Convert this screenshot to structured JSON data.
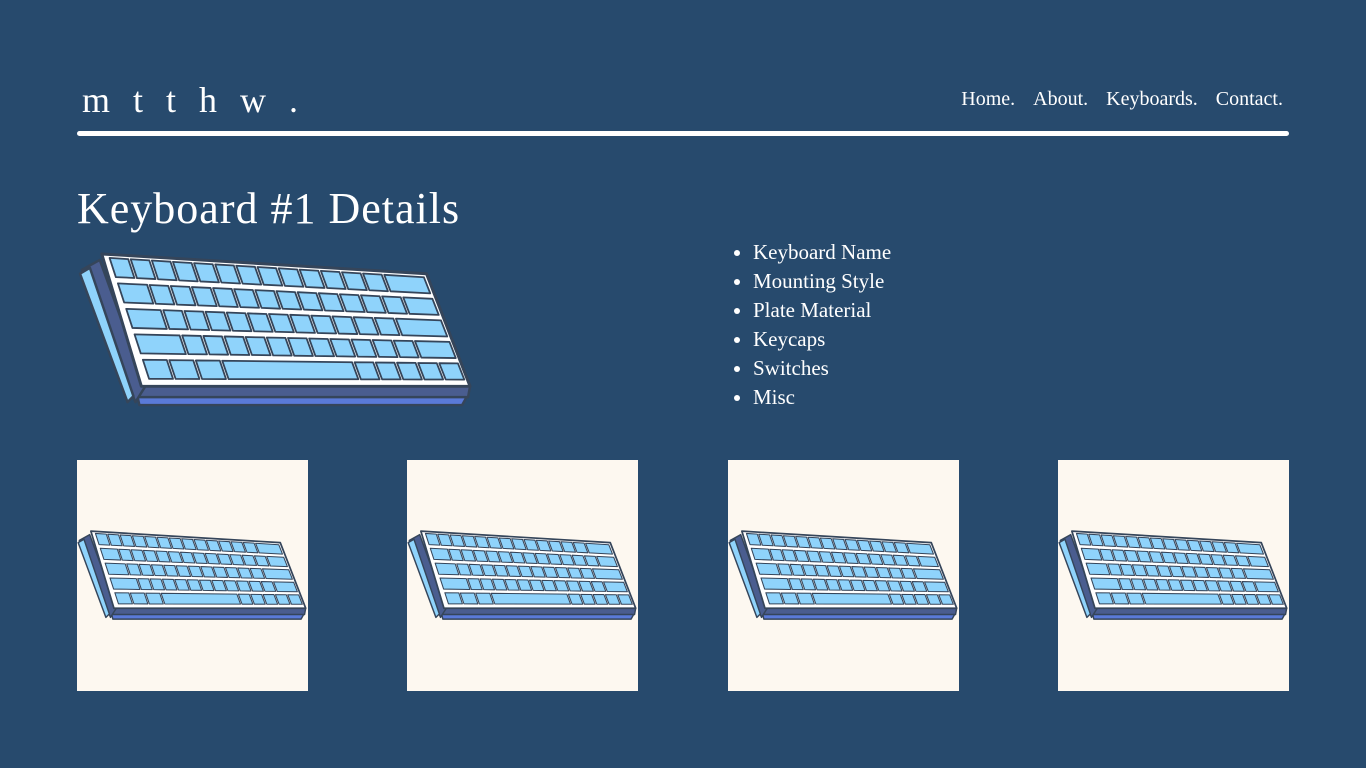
{
  "brand": {
    "logo_text": "m t t h w ."
  },
  "nav": {
    "items": [
      {
        "label": "Home."
      },
      {
        "label": "About."
      },
      {
        "label": "Keyboards."
      },
      {
        "label": "Contact."
      }
    ]
  },
  "page": {
    "title": "Keyboard #1 Details"
  },
  "details": {
    "items": [
      "Keyboard Name",
      "Mounting Style",
      "Plate Material",
      "Keycaps",
      "Switches",
      "Misc"
    ]
  },
  "colors": {
    "background": "#274a6d",
    "text": "#ffffff",
    "thumbnail_bg": "#fdf8f0",
    "key_fill": "#8fd3fb",
    "key_outline": "#35455a",
    "case_side": "#4a5d8f",
    "case_bottom": "#5a7ad8"
  },
  "icons": {
    "hero": "keyboard-illustration",
    "thumbnails": [
      "keyboard-illustration",
      "keyboard-illustration",
      "keyboard-illustration",
      "keyboard-illustration"
    ]
  }
}
